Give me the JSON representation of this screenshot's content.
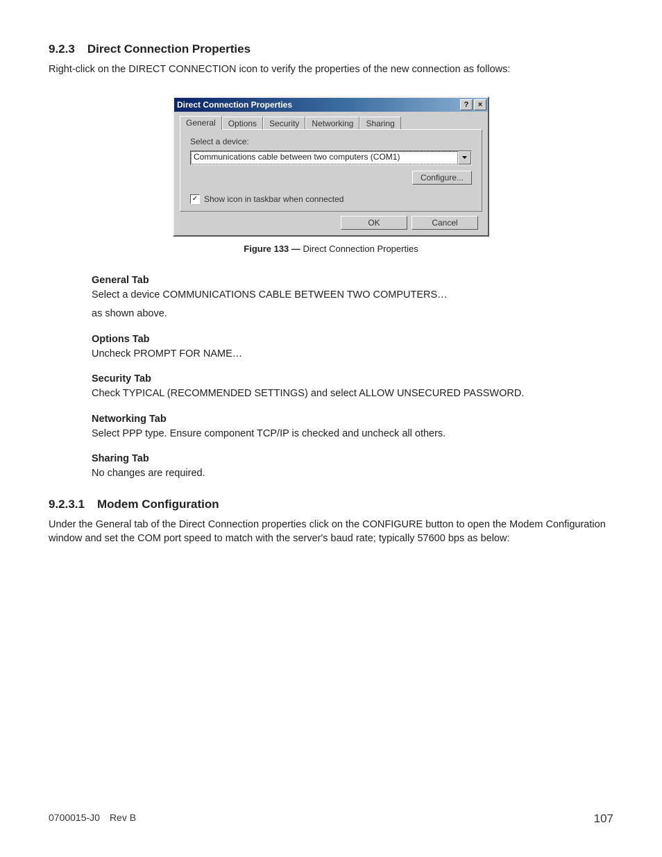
{
  "section1": {
    "num": "9.2.3",
    "title": "Direct Connection Properties",
    "intro": "Right-click on the DIRECT CONNECTION icon to verify the properties of the new connection as follows:"
  },
  "dialog": {
    "title": "Direct Connection Properties",
    "help_btn": "?",
    "close_btn": "×",
    "tabs": {
      "general": "General",
      "options": "Options",
      "security": "Security",
      "networking": "Networking",
      "sharing": "Sharing"
    },
    "field_label": "Select a device:",
    "device_value": "Communications cable between two computers (COM1)",
    "configure_btn": "Configure...",
    "checkbox_checked": "✓",
    "checkbox_label": "Show icon in taskbar when connected",
    "ok_btn": "OK",
    "cancel_btn": "Cancel"
  },
  "figure": {
    "label": "Figure 133  —",
    "caption": "  Direct Connection Properties"
  },
  "tabs_doc": {
    "general": {
      "h": "General Tab",
      "l1": "Select a device COMMUNICATIONS CABLE BETWEEN TWO COMPUTERS…",
      "l2": "as shown above."
    },
    "options": {
      "h": "Options Tab",
      "l1": "Uncheck PROMPT FOR NAME…"
    },
    "security": {
      "h": "Security Tab",
      "l1": "Check TYPICAL (RECOMMENDED SETTINGS) and select ALLOW UNSECURED PASSWORD."
    },
    "networking": {
      "h": "Networking Tab",
      "l1": "Select PPP type. Ensure component TCP/IP is checked and uncheck all others."
    },
    "sharing": {
      "h": "Sharing Tab",
      "l1": "No changes are required."
    }
  },
  "section2": {
    "num": "9.2.3.1",
    "title": "Modem Configuration",
    "body": "Under the General tab of the Direct Connection properties click on the CONFIGURE button to open the Modem Configuration window and set the COM port speed to match with the server's baud rate; typically 57600 bps as below:"
  },
  "footer": {
    "left": "0700015-J0 Rev B",
    "page": "107"
  }
}
